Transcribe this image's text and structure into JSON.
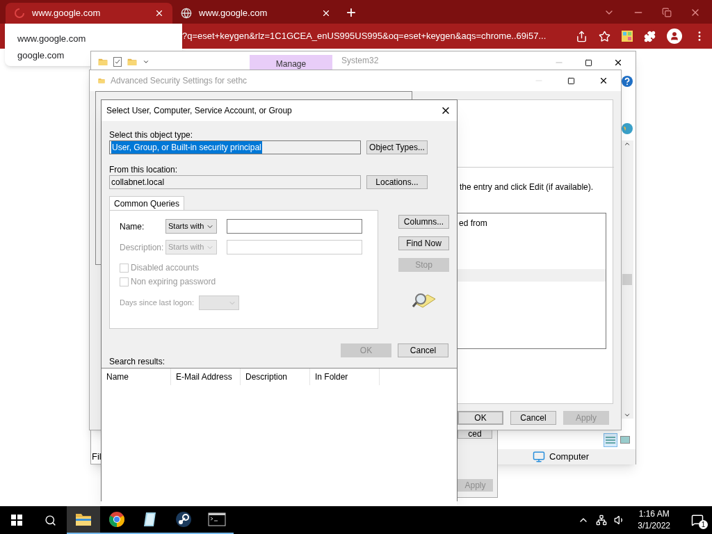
{
  "browser": {
    "tabs": [
      {
        "title": "www.google.com",
        "selected": true
      },
      {
        "title": "www.google.com",
        "selected": false
      }
    ],
    "new_tab": "+",
    "address": "?q=eset+keygen&rlz=1C1GCEA_enUS995US995&oq=eset+keygen&aqs=chrome..69i57...",
    "suggestion": {
      "title": "www.google.com",
      "subtitle": "google.com"
    }
  },
  "explorer": {
    "ribbon_tabs": [
      {
        "label": "Manage",
        "selected": true
      },
      {
        "label": "System32",
        "selected": false
      }
    ],
    "status_left": "Fil",
    "status_location": "Computer"
  },
  "security_window": {
    "title": "Advanced Security Settings for sethc",
    "instruction": "the entry and click Edit (if available).",
    "list_text": "ed from",
    "buttons": [
      {
        "label": "OK",
        "default": true,
        "disabled": false
      },
      {
        "label": "Cancel",
        "default": false,
        "disabled": false
      },
      {
        "label": "Apply",
        "default": false,
        "disabled": true
      }
    ]
  },
  "properties_window": {
    "buttons": [
      {
        "label": "ced",
        "disabled": false
      },
      {
        "label": "Apply",
        "disabled": true
      }
    ]
  },
  "dialog": {
    "title": "Select User, Computer, Service Account, or Group",
    "object_type_label": "Select this object type:",
    "object_type_value": "User, Group, or Built-in security principal",
    "object_types_button": "Object Types...",
    "location_label": "From this location:",
    "location_value": "collabnet.local",
    "locations_button": "Locations...",
    "tabs": [
      {
        "label": "Common Queries",
        "selected": true
      }
    ],
    "queries": [
      {
        "label": "Name:",
        "mode": "Starts with",
        "disabled": false
      },
      {
        "label": "Description:",
        "mode": "Starts with",
        "disabled": true
      }
    ],
    "checkboxes": [
      {
        "label": "Disabled accounts",
        "checked": false,
        "disabled": true
      },
      {
        "label": "Non expiring password",
        "checked": false,
        "disabled": true
      }
    ],
    "days_label": "Days since last logon:",
    "days_disabled": true,
    "side_buttons": [
      {
        "label": "Columns...",
        "disabled": false
      },
      {
        "label": "Find Now",
        "disabled": false
      },
      {
        "label": "Stop",
        "disabled": true
      }
    ],
    "buttons": [
      {
        "label": "OK",
        "disabled": true
      },
      {
        "label": "Cancel",
        "disabled": false
      }
    ],
    "results_label": "Search results:",
    "columns": [
      "Name",
      "E-Mail Address",
      "Description",
      "In Folder"
    ]
  },
  "taskbar": {
    "apps": [
      {
        "kind": "folder",
        "selected": true
      },
      {
        "kind": "chrome",
        "selected": false
      },
      {
        "kind": "notepad",
        "selected": false
      },
      {
        "kind": "steam",
        "selected": false
      },
      {
        "kind": "terminal",
        "selected": false
      }
    ],
    "time": "1:16 AM",
    "date": "3/1/2022",
    "notification_count": "1"
  }
}
